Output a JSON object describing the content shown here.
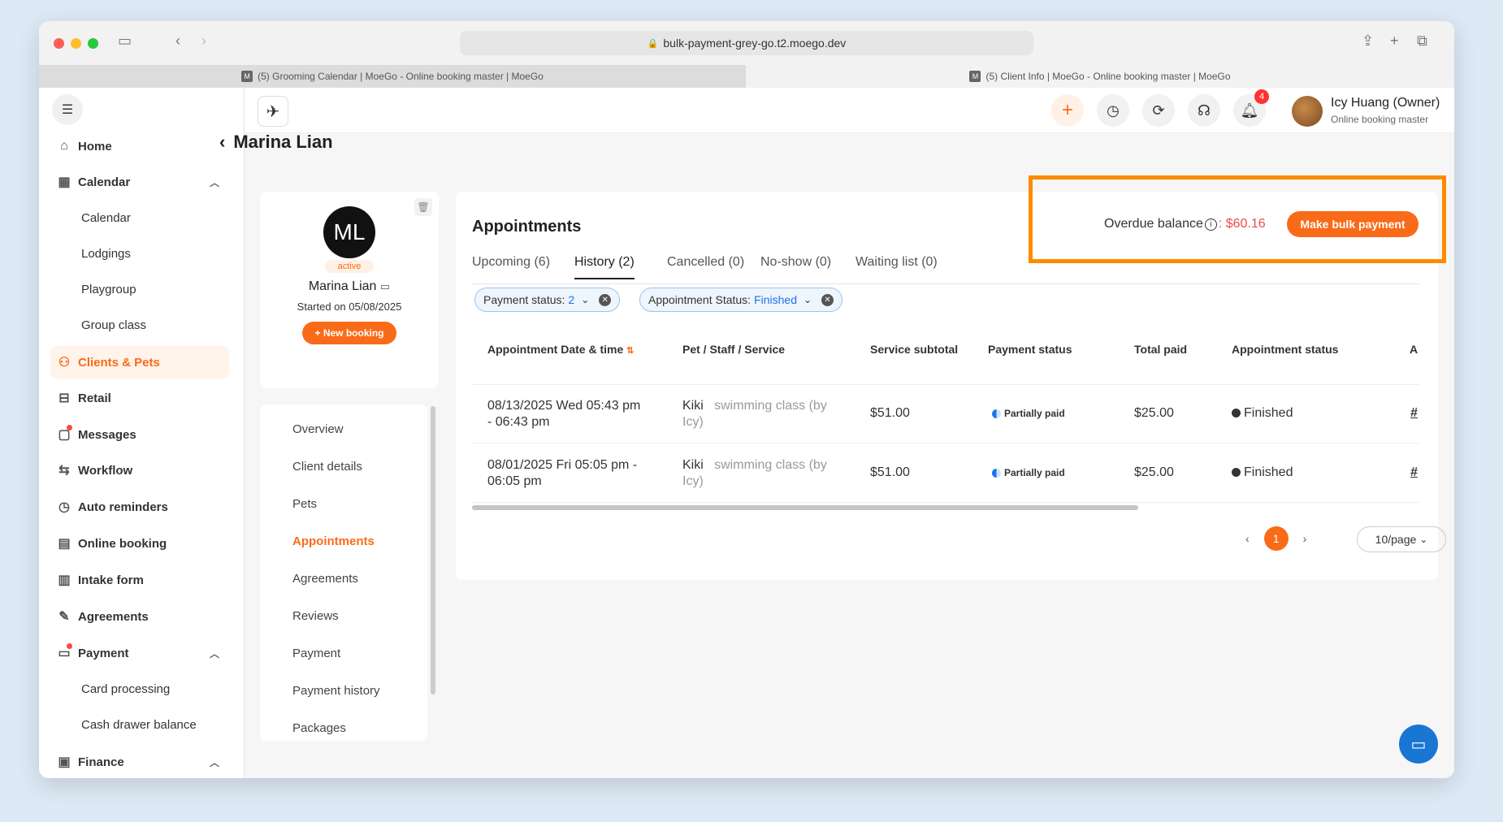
{
  "browser": {
    "url": "bulk-payment-grey-go.t2.moego.dev",
    "tabs": [
      "(5) Grooming Calendar | MoeGo - Online booking master | MoeGo",
      "(5) Client Info | MoeGo - Online booking master | MoeGo"
    ],
    "favicon": "M"
  },
  "sidebar": {
    "items": [
      {
        "label": "Home",
        "icon": "home-icon"
      },
      {
        "label": "Calendar",
        "icon": "calendar-icon"
      },
      {
        "label": "Calendar"
      },
      {
        "label": "Lodgings"
      },
      {
        "label": "Playgroup"
      },
      {
        "label": "Group class"
      },
      {
        "label": "Clients & Pets",
        "icon": "user-icon"
      },
      {
        "label": "Retail",
        "icon": "retail-icon"
      },
      {
        "label": "Messages",
        "icon": "message-icon"
      },
      {
        "label": "Workflow",
        "icon": "workflow-icon"
      },
      {
        "label": "Auto reminders",
        "icon": "alarm-icon"
      },
      {
        "label": "Online booking",
        "icon": "booking-icon"
      },
      {
        "label": "Intake form",
        "icon": "form-icon"
      },
      {
        "label": "Agreements",
        "icon": "pen-icon"
      },
      {
        "label": "Payment",
        "icon": "payment-icon"
      },
      {
        "label": "Card processing"
      },
      {
        "label": "Cash drawer balance"
      },
      {
        "label": "Finance",
        "icon": "finance-icon"
      }
    ]
  },
  "user": {
    "name": "Icy Huang (Owner)",
    "role": "Online booking master",
    "notifications": "4"
  },
  "client": {
    "name": "Marina Lian",
    "initials": "ML",
    "status": "active",
    "started": "Started on 05/08/2025",
    "new_booking": "+ New booking"
  },
  "client_nav": [
    "Overview",
    "Client details",
    "Pets",
    "Appointments",
    "Agreements",
    "Reviews",
    "Payment",
    "Payment history",
    "Packages"
  ],
  "appointments": {
    "title": "Appointments",
    "overdue_label": "Overdue balance",
    "overdue_amount": ": $60.16",
    "bulk_button": "Make bulk payment",
    "tabs": [
      "Upcoming (6)",
      "History (2)",
      "Cancelled (0)",
      "No-show (0)",
      "Waiting list (0)"
    ],
    "filters": [
      {
        "label": "Payment status: ",
        "value": "2"
      },
      {
        "label": "Appointment Status: ",
        "value": "Finished"
      }
    ],
    "columns": [
      "Appointment Date & time",
      "Pet / Staff / Service",
      "Service subtotal",
      "Payment status",
      "Total paid",
      "Appointment status",
      "A"
    ],
    "rows": [
      {
        "date1": "08/13/2025 Wed 05:43 pm",
        "date2": "- 06:43 pm",
        "pet": "Kiki",
        "svc1": "swimming class (by",
        "svc2": "Icy)",
        "subtotal": "$51.00",
        "payment": "Partially paid",
        "paid": "$25.00",
        "status": "Finished",
        "a": "#"
      },
      {
        "date1": "08/01/2025 Fri 05:05 pm -",
        "date2": "06:05 pm",
        "pet": "Kiki",
        "svc1": "swimming class (by",
        "svc2": "Icy)",
        "subtotal": "$51.00",
        "payment": "Partially paid",
        "paid": "$25.00",
        "status": "Finished",
        "a": "#"
      }
    ],
    "page": "1",
    "per_page": "10/page"
  },
  "colors": {
    "accent": "#f96b18",
    "highlight": "#ff8a00",
    "link": "#1a73e8",
    "danger": "#e94b4b"
  }
}
